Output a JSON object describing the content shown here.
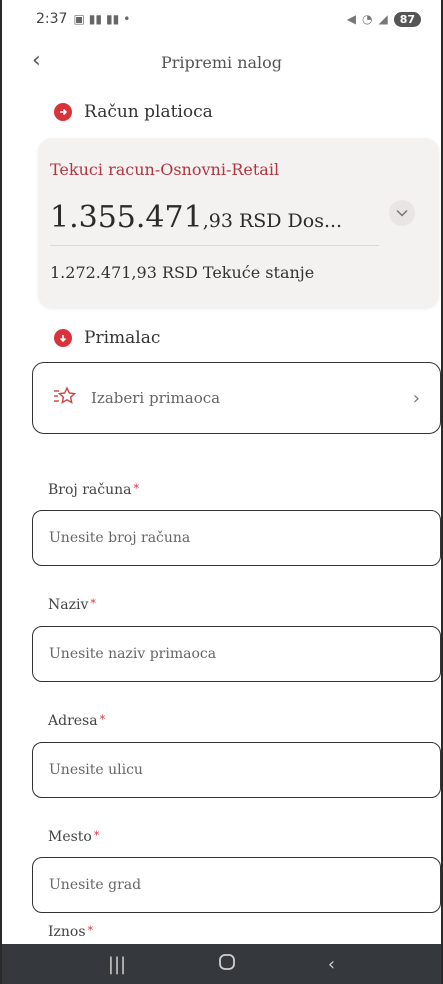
{
  "status_bar": {
    "time": "2:37",
    "battery": "87"
  },
  "header": {
    "title": "Pripremi nalog"
  },
  "payer_section": {
    "label": "Račun platioca"
  },
  "account": {
    "name": "Tekuci racun-Osnovni-Retail",
    "amount_int": "1.355.471",
    "amount_dec": ",93",
    "amount_rest": " RSD Dos...",
    "balance": "1.272.471,93 RSD Tekuće stanje"
  },
  "recipient_section": {
    "label": "Primalac"
  },
  "choose_recipient": {
    "label": "Izaberi primaoca"
  },
  "fields": {
    "account_number": {
      "label": "Broj računa",
      "required": "*",
      "placeholder": "Unesite broj računa",
      "value": ""
    },
    "name": {
      "label": "Naziv",
      "required": "*",
      "placeholder": "Unesite naziv primaoca",
      "value": ""
    },
    "address": {
      "label": "Adresa",
      "required": "*",
      "placeholder": "Unesite ulicu",
      "value": ""
    },
    "city": {
      "label": "Mesto",
      "required": "*",
      "placeholder": "Unesite grad",
      "value": ""
    },
    "amount": {
      "label": "Iznos",
      "required": "*"
    }
  },
  "colors": {
    "accent_red": "#d8323c",
    "account_name": "#b23540",
    "card_bg": "#f4f1f1",
    "navbar_bg": "#35393e"
  }
}
